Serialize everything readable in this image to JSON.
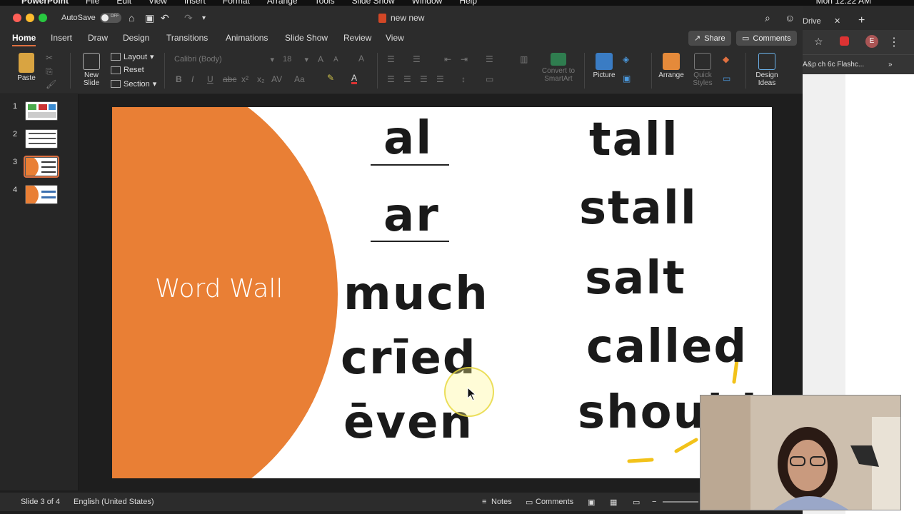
{
  "menubar": {
    "items": [
      "PowerPoint",
      "File",
      "Edit",
      "View",
      "Insert",
      "Format",
      "Arrange",
      "Tools",
      "Slide Show",
      "Window",
      "Help"
    ],
    "clock": "Mon 12:22 AM"
  },
  "titlebar": {
    "autosave_label": "AutoSave",
    "autosave_state": "OFF",
    "doc_title": "new new"
  },
  "tabs": [
    "Home",
    "Insert",
    "Draw",
    "Design",
    "Transitions",
    "Animations",
    "Slide Show",
    "Review",
    "View"
  ],
  "active_tab": "Home",
  "share_label": "Share",
  "comments_label": "Comments",
  "ribbon": {
    "paste": "Paste",
    "new_slide": "New Slide",
    "layout": "Layout",
    "reset": "Reset",
    "section": "Section",
    "font_name": "Calibri (Body)",
    "font_size": "18",
    "convert_smartart": "Convert to SmartArt",
    "picture": "Picture",
    "arrange": "Arrange",
    "quick_styles": "Quick Styles",
    "design_ideas": "Design Ideas"
  },
  "thumbnails": [
    {
      "num": "1"
    },
    {
      "num": "2"
    },
    {
      "num": "3",
      "selected": true
    },
    {
      "num": "4"
    }
  ],
  "slide": {
    "title": "Word Wall",
    "left_words": [
      {
        "text": "al",
        "underlined": true
      },
      {
        "text": "ar",
        "underlined": true
      },
      {
        "text": "much"
      },
      {
        "text": "crīed"
      },
      {
        "text": "ēven"
      }
    ],
    "right_words": [
      {
        "text": "tall"
      },
      {
        "text": "stall"
      },
      {
        "text": "salt"
      },
      {
        "text": "called"
      },
      {
        "text": "should"
      }
    ],
    "circle_color": "#E97F35"
  },
  "statusbar": {
    "slide_info": "Slide 3 of 4",
    "language": "English (United States)",
    "notes": "Notes",
    "comments": "Comments"
  },
  "browser": {
    "tab_label": "Drive",
    "bookmark": "A&p ch 6c Flashc...",
    "avatar": "E"
  }
}
